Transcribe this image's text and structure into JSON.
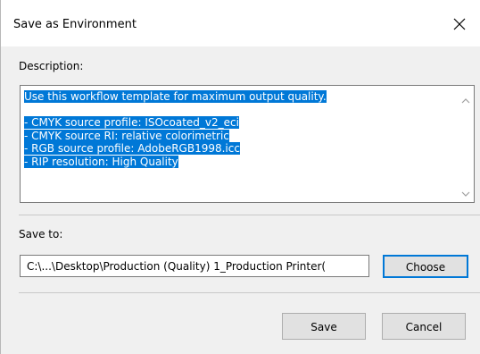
{
  "window": {
    "title": "Save as Environment"
  },
  "description": {
    "label": "Description:",
    "lines": [
      "Use this workflow template for maximum output quality.",
      "",
      "- CMYK source profile: ISOcoated_v2_eci",
      "- CMYK source RI: relative colorimetric",
      "- RGB source profile: AdobeRGB1998.icc",
      "- RIP resolution: High Quality"
    ],
    "selected": true
  },
  "save_to": {
    "label": "Save to:",
    "path": "C:\\...\\Desktop\\Production (Quality) 1_Production Printer(",
    "choose_label": "Choose"
  },
  "buttons": {
    "save_label": "Save",
    "cancel_label": "Cancel"
  },
  "icons": {
    "close": "close-icon",
    "scroll_up": "chevron-up-icon",
    "scroll_down": "chevron-down-icon"
  },
  "colors": {
    "selection": "#0078d7",
    "focus_border": "#0078d7"
  }
}
